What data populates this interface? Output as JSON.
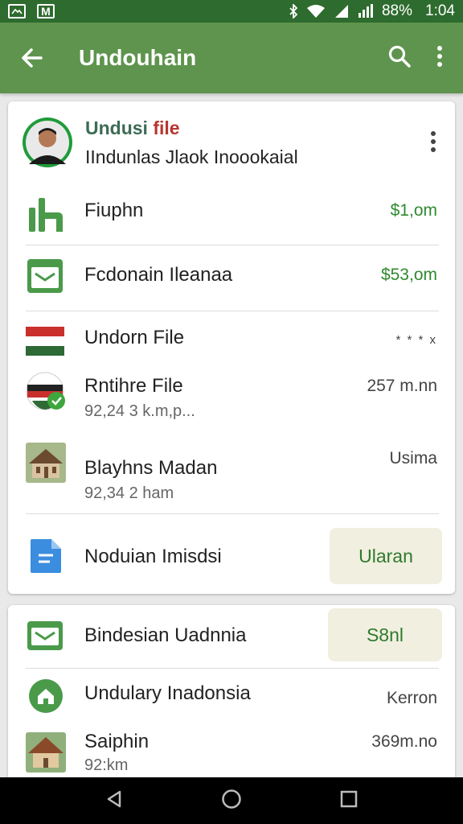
{
  "statusbar": {
    "icon_left_1": "notification-box-icon",
    "icon_left_2": "gmail-icon",
    "left2_label": "M",
    "battery": "88%",
    "time": "1:04"
  },
  "appbar": {
    "title": "Undouhain"
  },
  "header": {
    "title_part1": "Undusi",
    "title_part2": "file",
    "subtitle": "IIndunlas Jlaok Inoookaial"
  },
  "items": [
    {
      "title": "Fiuphn",
      "value": "$1,om"
    },
    {
      "title": "Fcdonain Ileanaa",
      "value": "$53,om"
    },
    {
      "title": "Undorn File",
      "value": "* * * x"
    },
    {
      "title": "Rntihre File",
      "subtitle": "92,24 3 k.m,p...",
      "value": "257 m.nn"
    },
    {
      "title": "Blayhns Madan",
      "subtitle": "92,34 2 ham",
      "value": "Usima"
    },
    {
      "title": "Noduian Imisdsi",
      "button": "Ularan"
    }
  ],
  "items2": [
    {
      "title": "Bindesian Uadnnia",
      "button": "S8nl"
    },
    {
      "title": "Undulary Inadonsia",
      "value": "Kerron"
    },
    {
      "title": "Saiphin",
      "subtitle": "92:km",
      "value": "369m.no"
    }
  ],
  "colors": {
    "appbar": "#5e944d",
    "statusbar": "#2e6b2e",
    "accent_green": "#2f8a2f",
    "title_red": "#b5372f"
  }
}
